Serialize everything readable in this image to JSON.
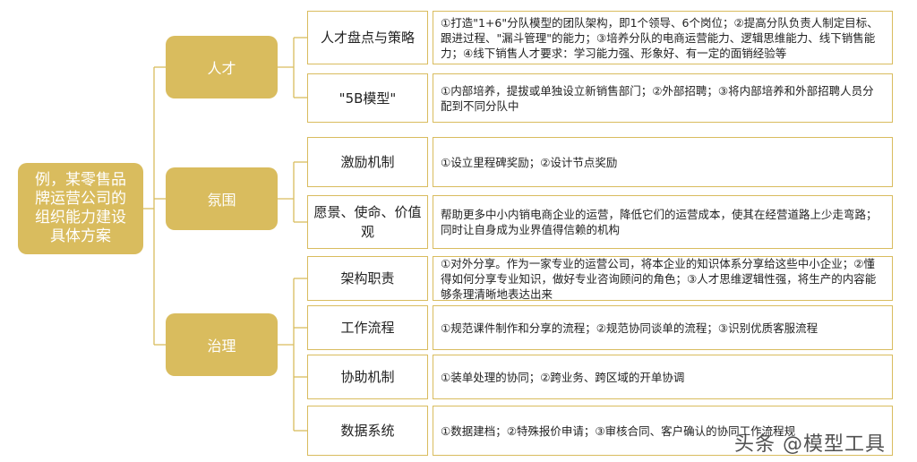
{
  "root": {
    "label": "例，某零售品牌运营公司的组织能力建设具体方案"
  },
  "categories": [
    {
      "label": "人才"
    },
    {
      "label": "氛围"
    },
    {
      "label": "治理"
    }
  ],
  "items": [
    {
      "label": "人才盘点与策略",
      "desc": "①打造\"1+6\"分队模型的团队架构，即1个领导、6个岗位；②提高分队负责人制定目标、跟进过程、\"漏斗管理\"的能力；③培养分队的电商运营能力、逻辑思维能力、线下销售能力；④线下销售人才要求：学习能力强、形象好、有一定的面销经验等"
    },
    {
      "label": "\"5B模型\"",
      "desc": "①内部培养，提拔或单独设立新销售部门；②外部招聘；③将内部培养和外部招聘人员分配到不同分队中"
    },
    {
      "label": "激励机制",
      "desc": "①设立里程碑奖励；②设计节点奖励"
    },
    {
      "label": "愿景、使命、价值观",
      "desc": "帮助更多中小内销电商企业的运营，降低它们的运营成本，使其在经营道路上少走弯路；同时让自身成为业界值得信赖的机构"
    },
    {
      "label": "架构职责",
      "desc": "①对外分享。作为一家专业的运营公司，将本企业的知识体系分享给这些中小企业；②懂得如何分享专业知识，做好专业咨询顾问的角色；③人才思维逻辑性强，将生产的内容能够条理清晰地表达出来"
    },
    {
      "label": "工作流程",
      "desc": "①规范课件制作和分享的流程；②规范协同谈单的流程；③识别优质客服流程"
    },
    {
      "label": "协助机制",
      "desc": "①装单处理的协同；②跨业务、跨区域的开单协调"
    },
    {
      "label": "数据系统",
      "desc": "①数据建档；②特殊报价申请；③审核合同、客户确认的协同工作流程规"
    }
  ],
  "watermark": "头条 @模型工具",
  "colors": {
    "accent": "#d9bc5e",
    "text": "#222222"
  }
}
